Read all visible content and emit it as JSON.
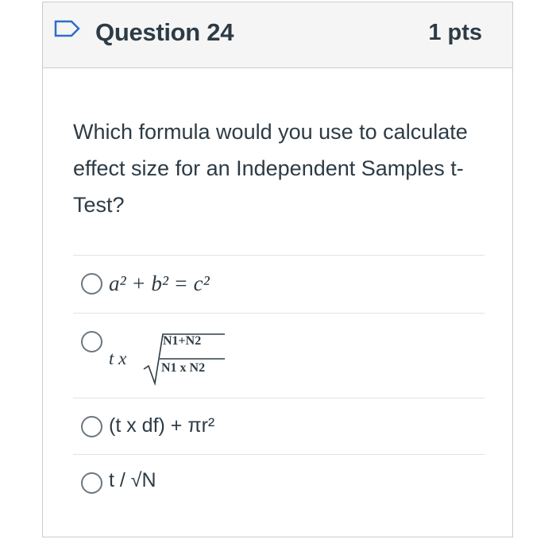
{
  "question": {
    "title": "Question 24",
    "points": "1 pts",
    "text": "Which formula would you use to calculate effect size for an Independent Samples t-Test?"
  },
  "answers": [
    {
      "label": "a² + b² = c²",
      "icon": "radio-unselected"
    },
    {
      "lead": "t x",
      "numerator": "N1+N2",
      "denominator": "N1 x N2",
      "icon": "radio-unselected"
    },
    {
      "label": "(t x df) + πr²",
      "icon": "radio-unselected"
    },
    {
      "label": "t / √N",
      "icon": "radio-unselected"
    }
  ],
  "colors": {
    "text": "#2d3b45",
    "header_bg": "#f5f5f5",
    "border": "#c7cdd1",
    "flag": "#2d6ec9"
  }
}
